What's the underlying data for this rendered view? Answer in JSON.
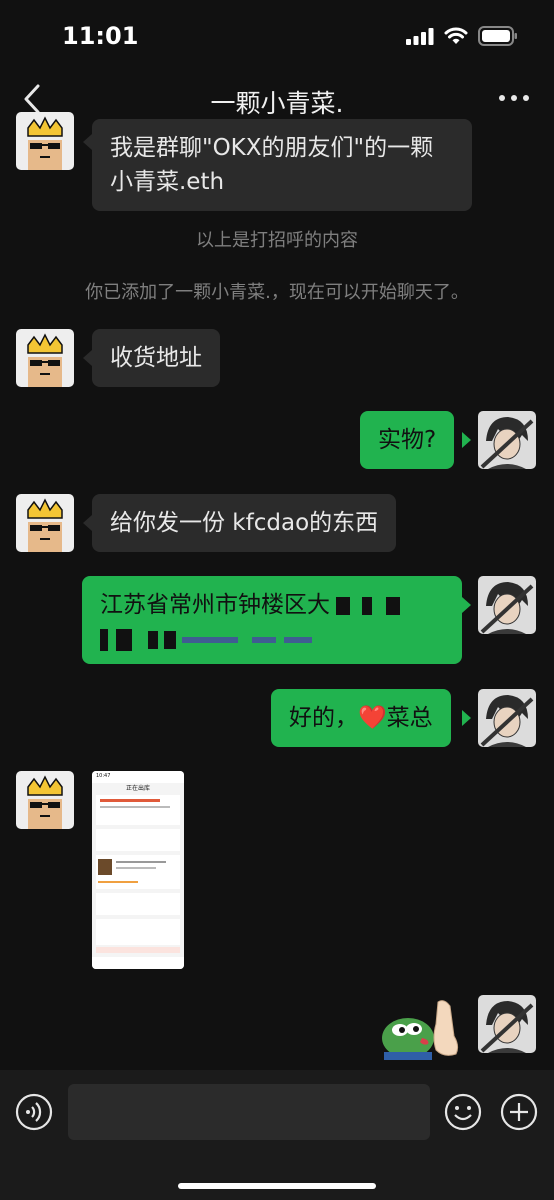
{
  "status_bar": {
    "time": "11:01"
  },
  "header": {
    "title": "一颗小青菜."
  },
  "messages": {
    "m1": {
      "line1": "我是群聊\"OKX的朋友们\"的一颗",
      "line2": "小青菜.eth"
    },
    "sys1": "以上是打招呼的内容",
    "sys2": "你已添加了一颗小青菜.，现在可以开始聊天了。",
    "m2": "收货地址",
    "m3": "实物?",
    "m4": "给你发一份 kfcdao的东西",
    "m5": {
      "line1": "江苏省常州市钟楼区大"
    },
    "m6": {
      "before": "好的，",
      "emoji": "❤️",
      "after": "菜总"
    }
  },
  "screenshot_thumb": {
    "time": "10:47",
    "title": "正在出库"
  },
  "colors": {
    "bg": "#111111",
    "bubble_in": "#2b2b2b",
    "bubble_out": "#21b34f",
    "input_bar": "#1b1b1b"
  },
  "icons": {
    "back": "chevron-left-icon",
    "more": "more-dots-icon",
    "voice": "voice-icon",
    "emoji": "emoji-icon",
    "plus": "plus-icon"
  }
}
